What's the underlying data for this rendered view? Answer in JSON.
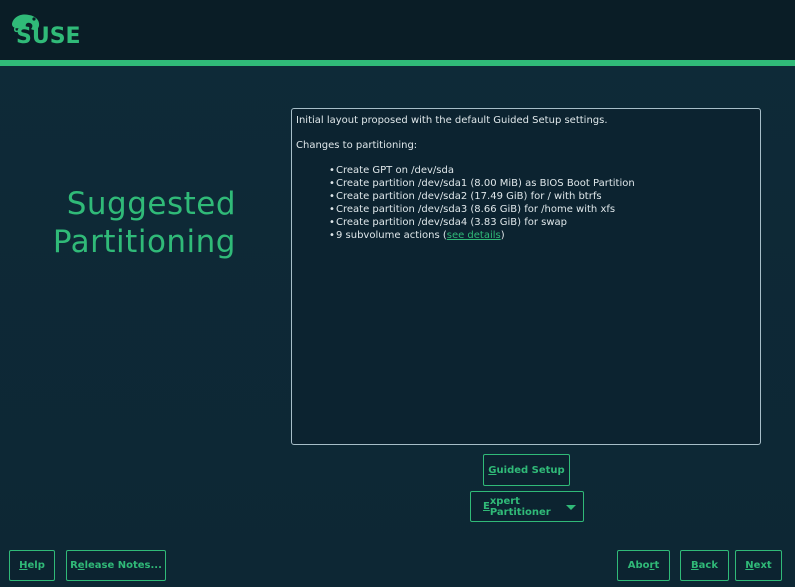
{
  "brand": {
    "logo_text": "SUSE",
    "accent_color": "#30ba78"
  },
  "page": {
    "title_line1": "Suggested",
    "title_line2": "Partitioning"
  },
  "proposal": {
    "intro": "Initial layout proposed with the default Guided Setup settings.",
    "changes_heading": "Changes to partitioning:",
    "items": [
      "Create GPT on /dev/sda",
      "Create partition /dev/sda1 (8.00 MiB) as BIOS Boot Partition",
      "Create partition /dev/sda2 (17.49 GiB) for / with btrfs",
      "Create partition /dev/sda3 (8.66 GiB) for /home with xfs",
      "Create partition /dev/sda4 (3.83 GiB) for swap"
    ],
    "subvolume_prefix": "9 subvolume actions (",
    "subvolume_link": "see details",
    "subvolume_suffix": ")"
  },
  "buttons": {
    "guided_setup": {
      "hotkey": "G",
      "rest": "uided Setup"
    },
    "expert_partitioner": {
      "hotkey": "E",
      "rest": "xpert Partitioner"
    },
    "help": {
      "hotkey": "H",
      "rest": "elp"
    },
    "release_notes": {
      "pre": "R",
      "hotkey": "e",
      "rest": "lease Notes..."
    },
    "abort": {
      "pre": "Abo",
      "hotkey": "r",
      "rest": "t"
    },
    "back": {
      "hotkey": "B",
      "rest": "ack"
    },
    "next": {
      "hotkey": "N",
      "rest": "ext"
    }
  }
}
